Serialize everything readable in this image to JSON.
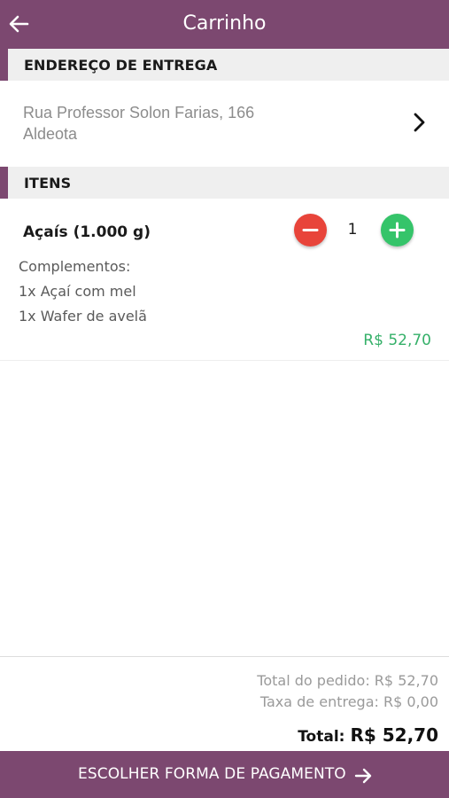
{
  "header": {
    "title": "Carrinho",
    "back_icon": "arrow-left-icon",
    "background_color": "#7c4870"
  },
  "address_section": {
    "heading": "ENDEREÇO DE ENTREGA",
    "street": "Rua Professor Solon Farias, 166",
    "neighborhood": "Aldeota",
    "chevron_icon": "chevron-right-icon"
  },
  "items_section": {
    "heading": "ITENS",
    "items": [
      {
        "name": "Açaís (1.000 g)",
        "quantity": "1",
        "complements_heading": "Complementos:",
        "complements": [
          "1x Açaí com mel",
          "1x Wafer de avelã"
        ],
        "price": "R$ 52,70",
        "minus_icon": "minus-icon",
        "plus_icon": "plus-icon"
      }
    ]
  },
  "summary": {
    "order_total": "Total do pedido: R$ 52,70",
    "delivery_fee": "Taxa de entrega: R$ 0,00",
    "total_label": "Total:",
    "total_value": "R$ 52,70"
  },
  "footer": {
    "pay_button_label": "ESCOLHER FORMA DE PAGAMENTO",
    "pay_arrow_icon": "arrow-right-icon"
  },
  "colors": {
    "brand": "#7c4870",
    "minus_button": "#e8443a",
    "plus_button": "#35c46a",
    "price": "#35b069"
  }
}
